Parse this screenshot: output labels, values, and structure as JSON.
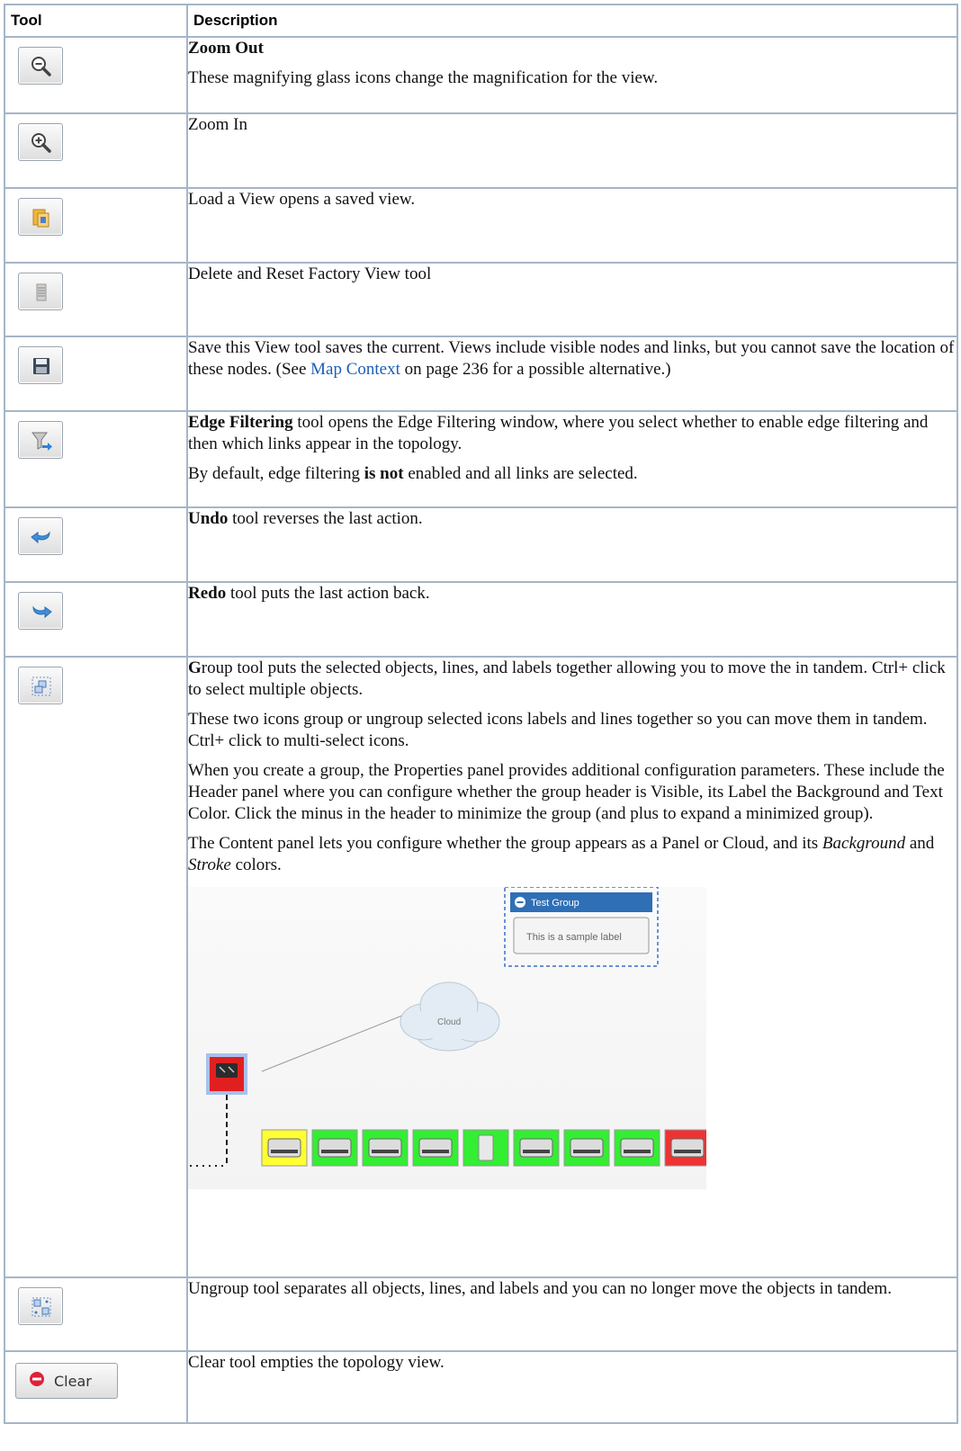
{
  "headers": {
    "tool": "Tool",
    "description": "Description"
  },
  "rows": {
    "zoom_out": {
      "icon": "zoom-out-icon",
      "title": "Zoom Out",
      "text": "These magnifying glass icons change the magnification for the view."
    },
    "zoom_in": {
      "icon": "zoom-in-icon",
      "text": "Zoom In"
    },
    "load_view": {
      "icon": "load-view-icon",
      "text": "Load a View opens a saved view."
    },
    "delete_reset": {
      "icon": "delete-reset-icon",
      "text": "Delete and Reset Factory View tool"
    },
    "save_view": {
      "icon": "save-icon",
      "text_before": "Save this View tool saves the current. Views include visible nodes and links, but you cannot save the location of these nodes. (See ",
      "link": "Map Context",
      "text_after": " on page 236 for a possible alternative.)"
    },
    "edge_filtering": {
      "icon": "edge-filter-icon",
      "bold": "Edge Filtering",
      "text": " tool opens the Edge Filtering window, where you select whether to enable edge filtering and then which links appear in the topology.",
      "note_before": "By default, edge filtering ",
      "note_bold": "is not",
      "note_after": " enabled and all links are selected."
    },
    "undo": {
      "icon": "undo-icon",
      "bold": "Undo",
      "text": " tool reverses the last action."
    },
    "redo": {
      "icon": "redo-icon",
      "bold": "Redo",
      "text": " tool puts the last action back."
    },
    "group": {
      "icon": "group-icon",
      "bold": "G",
      "p1": "roup tool puts the selected objects, lines, and labels together allowing you to move the in tandem. Ctrl+ click to select multiple objects.",
      "p2": "These two icons group or ungroup selected icons labels and lines together so you can move them in tandem. Ctrl+ click to multi-select icons.",
      "p3": "When you create a group, the Properties panel provides additional configuration parameters. These include the Header panel where you can configure whether the group header is Visible, its Label the Background and Text Color. Click the minus in the header to minimize the group (and plus to expand a minimized group).",
      "p4_a": "The Content panel lets you configure whether the group appears as a Panel or Cloud, and its ",
      "p4_bg": "Background",
      "p4_mid": " and ",
      "p4_stroke": "Stroke",
      "p4_end": " colors.",
      "screenshot": {
        "group_title": "Test Group",
        "group_label": "This is a sample label",
        "cloud_label": "Cloud",
        "node_colors": [
          "#ffff33",
          "#33ee33",
          "#33ee33",
          "#33ee33",
          "#33ee33",
          "#33ee33",
          "#33ee33",
          "#33ee33",
          "#ee3333"
        ]
      }
    },
    "ungroup": {
      "icon": "ungroup-icon",
      "text": "Ungroup tool separates all objects, lines, and labels and you can no longer move the objects in tandem."
    },
    "clear": {
      "icon": "clear-icon",
      "button_label": "Clear",
      "text": "Clear tool empties the topology view."
    }
  }
}
